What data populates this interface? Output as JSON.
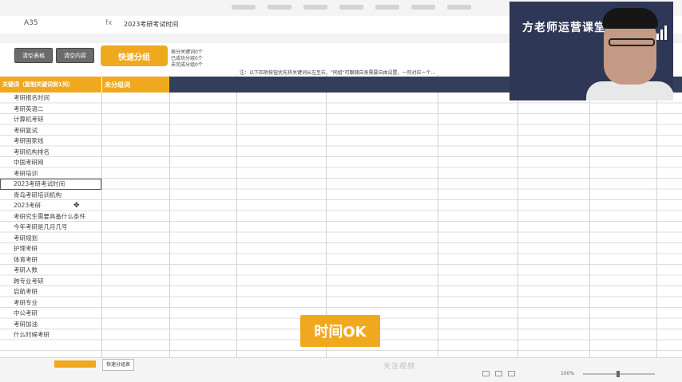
{
  "toolbar": {
    "cell_ref": "A35",
    "fx": "fx",
    "formula_value": "2023考研考试时间"
  },
  "controls": {
    "clear_table_label": "清空表格",
    "clear_content_label": "清空内容",
    "quick_group_label": "快速分组",
    "stats_line1": "按分关键词0个",
    "stats_line2": "已成功分组0个",
    "stats_line3": "未完成分组0个",
    "note": "注：以下四项按钮优先将关键词从左至右，\"同组\"可跟随自身需要自由设置，一列对应一个…"
  },
  "header": {
    "keyword_col": "关键词（复制关键词到1列）",
    "ungrouped_col": "未分组词"
  },
  "keywords": [
    "考研报名时间",
    "考研英语二",
    "计算机考研",
    "考研复试",
    "考研国家线",
    "考研机构排名",
    "中国考研网",
    "考研培训",
    "2023考研考试时间",
    "青岛考研培训机构",
    "2023考研",
    "考研究生需要具备什么条件",
    "今年考研是几月几号",
    "考研规划",
    "护理考研",
    "体育考研",
    "考研人数",
    "跨专业考研",
    "启航考研",
    "考研专业",
    "中公考研",
    "考研加油",
    "什么时候考研"
  ],
  "selected_index": 8,
  "video": {
    "overlay_text": "方老师运营课堂"
  },
  "subtitle": "时间OK",
  "status": {
    "sheet_tab": "快速分组表",
    "zoom": "100%",
    "watermark": "关注视频"
  },
  "colors": {
    "accent": "#f0a91f",
    "header_dark": "#333f5a"
  }
}
